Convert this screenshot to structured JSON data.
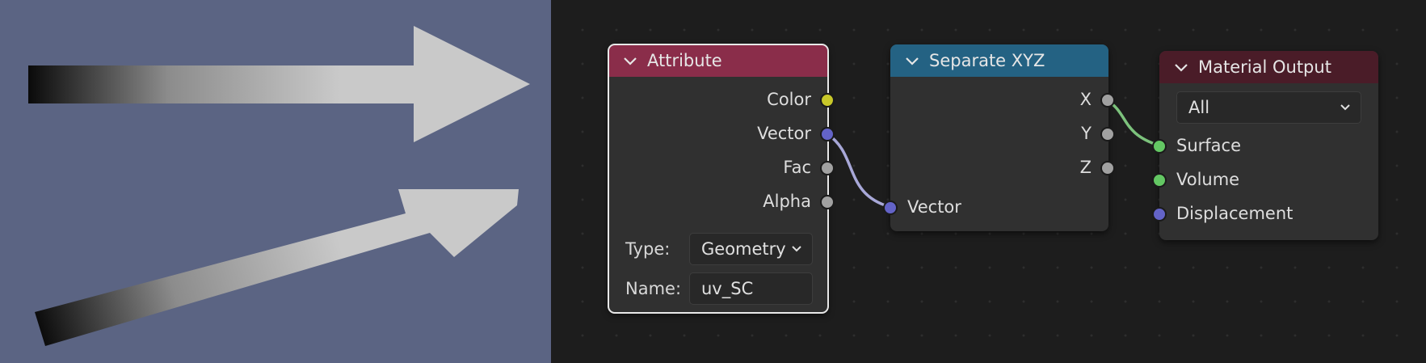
{
  "nodes": {
    "attribute": {
      "title": "Attribute",
      "header_color": "#8a2d4a",
      "outputs": [
        "Color",
        "Vector",
        "Fac",
        "Alpha"
      ],
      "type_label": "Type:",
      "type_value": "Geometry",
      "name_label": "Name:",
      "name_value": "uv_SC"
    },
    "separate_xyz": {
      "title": "Separate XYZ",
      "header_color": "#246283",
      "outputs": [
        "X",
        "Y",
        "Z"
      ],
      "input": "Vector"
    },
    "material_output": {
      "title": "Material Output",
      "header_color": "#4a1c28",
      "target": "All",
      "inputs": [
        "Surface",
        "Volume",
        "Displacement"
      ]
    }
  },
  "socket_colors": {
    "color": "#c7c729",
    "vector": "#6363c7",
    "float": "#a1a1a1",
    "shader": "#63c763"
  },
  "viewport_background": "#5b6483"
}
